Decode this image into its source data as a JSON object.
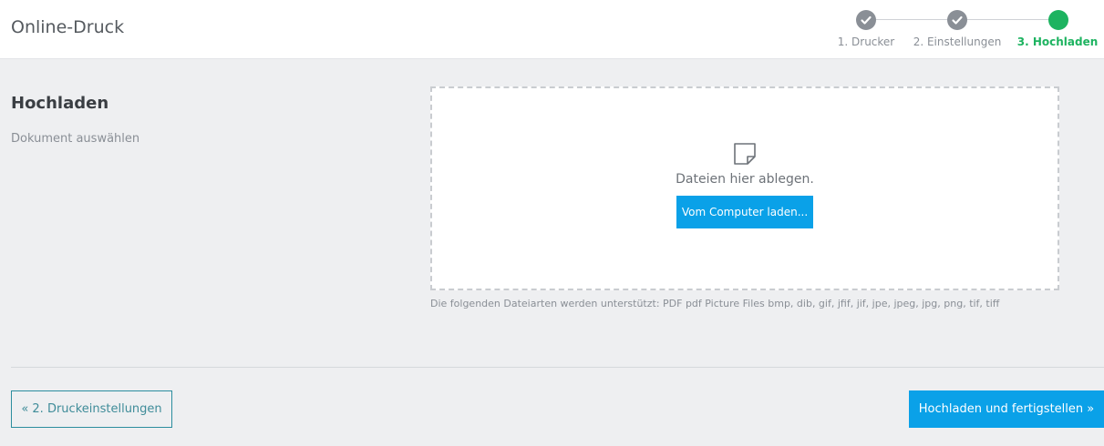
{
  "header": {
    "title": "Online-Druck"
  },
  "stepper": {
    "steps": [
      {
        "label": "1. Drucker",
        "state": "done",
        "icon": "check-icon"
      },
      {
        "label": "2. Einstellungen",
        "state": "done",
        "icon": "check-icon"
      },
      {
        "label": "3. Hochladen",
        "state": "active"
      }
    ],
    "colors": {
      "done": "#8a8f96",
      "active": "#1db360"
    }
  },
  "section": {
    "title": "Hochladen",
    "subtitle": "Dokument auswählen"
  },
  "dropzone": {
    "icon": "file-icon",
    "text": "Dateien hier ablegen.",
    "button_label": "Vom Computer laden..."
  },
  "filetypes_text": "Die folgenden Dateiarten werden unterstützt: PDF pdf Picture Files bmp, dib, gif, jfif, jif, jpe, jpeg, jpg, png, tif, tiff",
  "footer": {
    "back_label": "« 2. Druckeinstellungen",
    "finish_label": "Hochladen und fertigstellen »"
  },
  "colors": {
    "accent": "#0aa1e8",
    "success": "#1db360"
  }
}
